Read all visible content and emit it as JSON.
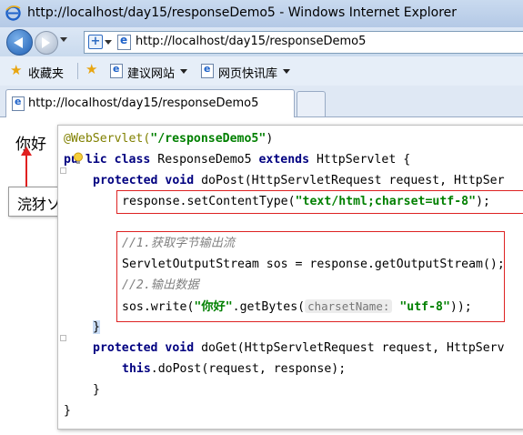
{
  "window": {
    "title": "http://localhost/day15/responseDemo5 - Windows Internet Explorer"
  },
  "address_bar": {
    "url": "http://localhost/day15/responseDemo5"
  },
  "favorites_bar": {
    "favorites_label": "收藏夹",
    "items": [
      {
        "label": "建议网站"
      },
      {
        "label": "网页快讯库"
      }
    ]
  },
  "tabs": [
    {
      "title": "http://localhost/day15/responseDemo5",
      "active": true
    }
  ],
  "page": {
    "output_text": "你好",
    "garbled_output": "浣犲ソ"
  },
  "code": {
    "line1_annotation": "@WebServlet(",
    "line1_string": "\"/responseDemo5\"",
    "line1_end": ")",
    "line2_pre": "pu",
    "line2_kw1": "lic class",
    "line2_mid": " ResponseDemo5 ",
    "line2_kw2": "extends",
    "line2_end": " HttpServlet {",
    "line3_kw": "protected void",
    "line3_rest": " doPost(HttpServletRequest request, HttpSer",
    "line4_code": "response.setContentType(",
    "line4_string": "\"text/html;charset=utf-8\"",
    "line4_end": ");",
    "line5_comment": "//1.获取字节输出流",
    "line6_code": "ServletOutputStream sos = response.getOutputStream();",
    "line7_comment": "//2.输出数据",
    "line8_code": "sos.write(",
    "line8_string": "\"你好\"",
    "line8_mid": ".getBytes(",
    "line8_hint": "charsetName:",
    "line8_string2": "\"utf-8\"",
    "line8_end": "));",
    "line9_brace": "}",
    "line10_kw": "protected void",
    "line10_rest": " doGet(HttpServletRequest request, HttpServ",
    "line11_kw": "this",
    "line11_rest": ".doPost(request, response);",
    "line12_brace": "}",
    "line13_brace": "}"
  },
  "colors": {
    "keyword": "#000080",
    "string": "#008000",
    "annotation": "#808000",
    "comment": "#808080",
    "highlight_box": "#dd2222"
  }
}
